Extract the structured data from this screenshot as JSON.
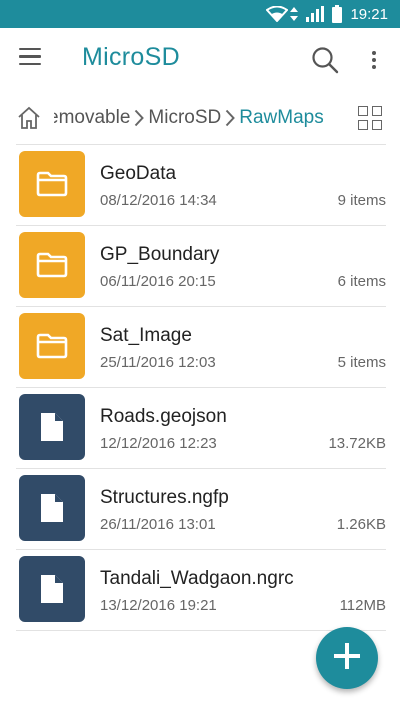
{
  "status_bar": {
    "time": "19:21",
    "icons": [
      "wifi-icon",
      "data-arrows-icon",
      "signal-icon",
      "battery-icon"
    ]
  },
  "app_bar": {
    "title": "MicroSD",
    "icons": [
      "menu-icon",
      "search-icon",
      "more-vert-icon"
    ]
  },
  "breadcrumb": {
    "items": [
      "Removable",
      "MicroSD",
      "RawMaps"
    ],
    "visible_first": "emovable",
    "icons": [
      "home-icon",
      "chevron-right-icon",
      "grid-view-icon"
    ]
  },
  "files": [
    {
      "name": "GeoData",
      "date": "08/12/2016 14:34",
      "meta": "9 items",
      "type": "folder"
    },
    {
      "name": "GP_Boundary",
      "date": "06/11/2016 20:15",
      "meta": "6 items",
      "type": "folder"
    },
    {
      "name": "Sat_Image",
      "date": "25/11/2016 12:03",
      "meta": "5 items",
      "type": "folder"
    },
    {
      "name": "Roads.geojson",
      "date": "12/12/2016 12:23",
      "meta": "13.72KB",
      "type": "file"
    },
    {
      "name": "Structures.ngfp",
      "date": "26/11/2016 13:01",
      "meta": "1.26KB",
      "type": "file"
    },
    {
      "name": "Tandali_Wadgaon.ngrc",
      "date": "13/12/2016 19:21",
      "meta": "112MB",
      "type": "file"
    }
  ],
  "fab": {
    "icon": "add-icon"
  },
  "colors": {
    "accent": "#1e8c9c",
    "folder": "#f0a826",
    "file": "#314b68"
  }
}
